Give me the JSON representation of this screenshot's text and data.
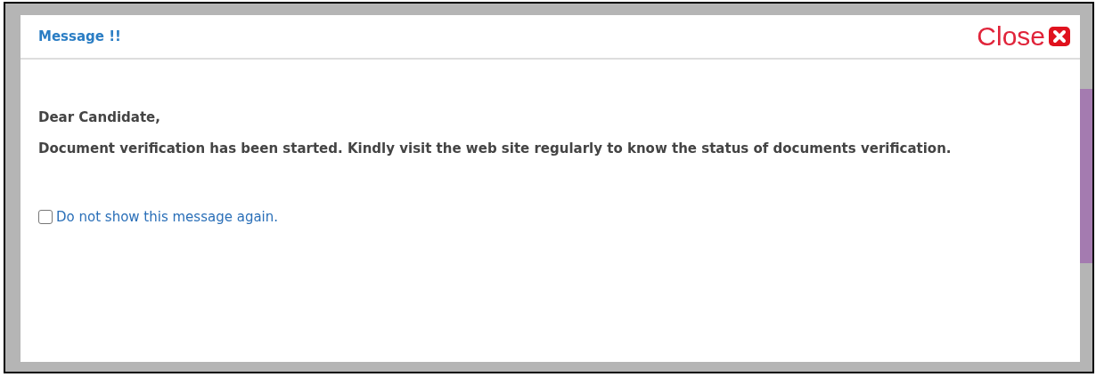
{
  "dialog": {
    "title": "Message !!",
    "close_label": "Close",
    "greeting": "Dear Candidate,",
    "message": "Document verification has been started. Kindly visit the web site regularly to know the status of documents verification.",
    "checkbox": {
      "label": "Do not show this message again.",
      "checked": false
    }
  }
}
